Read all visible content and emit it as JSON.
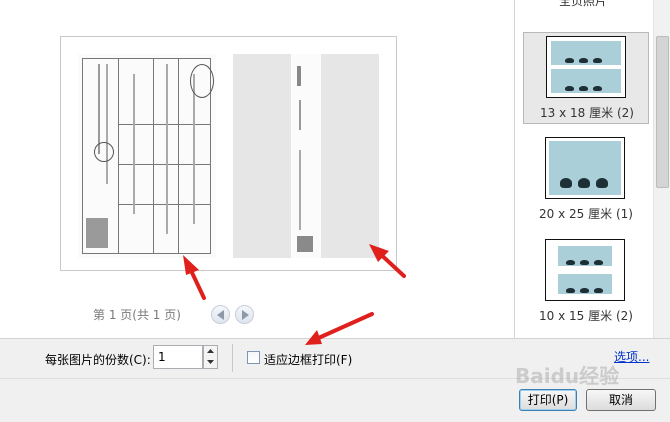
{
  "pager": {
    "text": "第 1 页(共 1 页)"
  },
  "sidebar": {
    "top_label": "全页照片",
    "items": [
      {
        "label": "13 x 18 厘米 (2)",
        "selected": true
      },
      {
        "label": "20 x 25 厘米 (1)",
        "selected": false
      },
      {
        "label": "10 x 15 厘米 (2)",
        "selected": false
      }
    ]
  },
  "options": {
    "copies_label": "每张图片的份数(C):",
    "copies_value": "1",
    "fit_label": "适应边框打印(F)",
    "fit_checked": false,
    "link_label": "选项..."
  },
  "buttons": {
    "print": "打印(P)",
    "cancel": "取消"
  },
  "watermark": "Baidu经验",
  "colors": {
    "annotation_arrow": "#e0201c",
    "link": "#0033cc",
    "thumb_sky": "#aacfd8"
  }
}
